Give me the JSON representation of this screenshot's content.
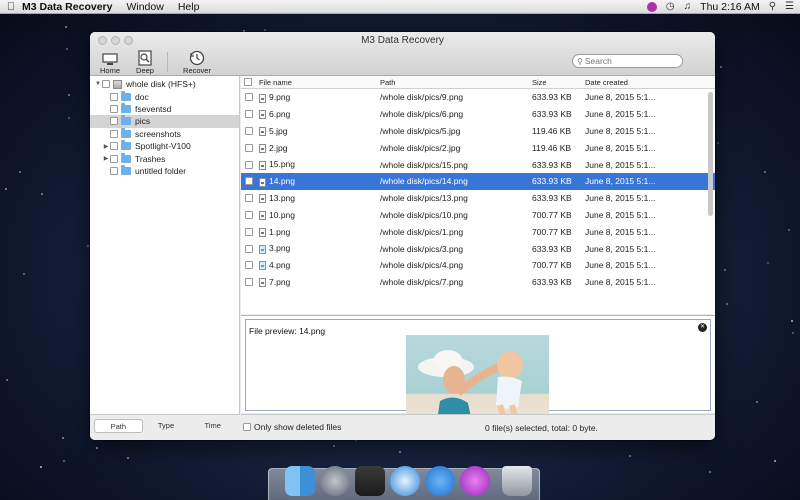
{
  "menubar": {
    "app_name": "M3 Data Recovery",
    "menus": [
      "Window",
      "Help"
    ],
    "clock": "Thu 2:16 AM"
  },
  "window": {
    "title": "M3 Data Recovery",
    "toolbar": {
      "home": "Home",
      "deep_scan": "Deep Scan",
      "recover": "Recover"
    },
    "search": {
      "placeholder": "Search"
    }
  },
  "tree": [
    {
      "label": "whole disk (HFS+)",
      "kind": "disk",
      "expanded": true,
      "level": 0
    },
    {
      "label": "doc",
      "kind": "folder",
      "level": 1
    },
    {
      "label": "fseventsd",
      "kind": "folder",
      "level": 1
    },
    {
      "label": "pics",
      "kind": "folder",
      "level": 1,
      "selected": true
    },
    {
      "label": "screenshots",
      "kind": "folder",
      "level": 1
    },
    {
      "label": "Spotlight-V100",
      "kind": "folder",
      "level": 1,
      "collapsed": true
    },
    {
      "label": "Trashes",
      "kind": "folder",
      "level": 1,
      "collapsed": true
    },
    {
      "label": "untitled folder",
      "kind": "folder",
      "level": 1
    }
  ],
  "sidebar_tabs": [
    "Path",
    "Type",
    "Time"
  ],
  "table": {
    "columns": {
      "name": "File name",
      "path": "Path",
      "size": "Size",
      "date": "Date created"
    },
    "rows": [
      {
        "name": "9.png",
        "path": "/whole disk/pics/9.png",
        "size": "633.93 KB",
        "date": "June 8, 2015 5:1...",
        "icon": "file"
      },
      {
        "name": "6.png",
        "path": "/whole disk/pics/6.png",
        "size": "633.93 KB",
        "date": "June 8, 2015 5:1...",
        "icon": "file"
      },
      {
        "name": "5.jpg",
        "path": "/whole disk/pics/5.jpg",
        "size": "119.46 KB",
        "date": "June 8, 2015 5:1...",
        "icon": "file"
      },
      {
        "name": "2.jpg",
        "path": "/whole disk/pics/2.jpg",
        "size": "119.46 KB",
        "date": "June 8, 2015 5:1...",
        "icon": "file"
      },
      {
        "name": "15.png",
        "path": "/whole disk/pics/15.png",
        "size": "633.93 KB",
        "date": "June 8, 2015 5:1...",
        "icon": "file"
      },
      {
        "name": "14.png",
        "path": "/whole disk/pics/14.png",
        "size": "633.93 KB",
        "date": "June 8, 2015 5:1...",
        "icon": "file",
        "selected": true
      },
      {
        "name": "13.png",
        "path": "/whole disk/pics/13.png",
        "size": "633.93 KB",
        "date": "June 8, 2015 5:1...",
        "icon": "file"
      },
      {
        "name": "10.png",
        "path": "/whole disk/pics/10.png",
        "size": "700.77 KB",
        "date": "June 8, 2015 5:1...",
        "icon": "file"
      },
      {
        "name": "1.png",
        "path": "/whole disk/pics/1.png",
        "size": "700.77 KB",
        "date": "June 8, 2015 5:1...",
        "icon": "file"
      },
      {
        "name": "3.png",
        "path": "/whole disk/pics/3.png",
        "size": "633.93 KB",
        "date": "June 8, 2015 5:1...",
        "icon": "trash"
      },
      {
        "name": "4.png",
        "path": "/whole disk/pics/4.png",
        "size": "700.77 KB",
        "date": "June 8, 2015 5:1...",
        "icon": "trash"
      },
      {
        "name": "7.png",
        "path": "/whole disk/pics/7.png",
        "size": "633.93 KB",
        "date": "June 8, 2015 5:1...",
        "icon": "file"
      }
    ]
  },
  "preview": {
    "label": "File preview: 14.png"
  },
  "bottom": {
    "only_deleted_label": "Only show deleted files",
    "status": "0 file(s) selected, total: 0 byte."
  },
  "dock": [
    "Finder",
    "Launchpad",
    "Photo Booth",
    "Safari",
    "App Store",
    "iTunes",
    "Trash"
  ],
  "colors": {
    "selection": "#3875d7",
    "folder": "#6fb0ea"
  }
}
